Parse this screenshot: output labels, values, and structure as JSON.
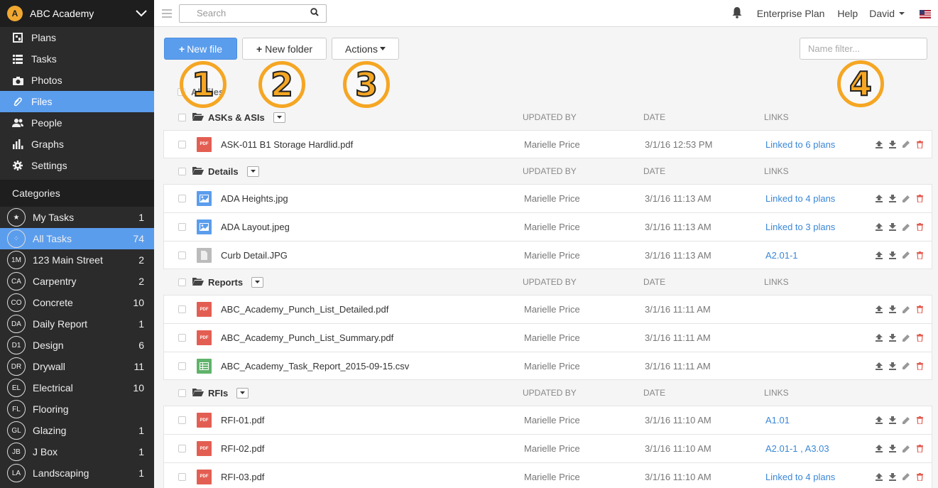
{
  "brand": {
    "logo_text": "A",
    "name": "ABC Academy"
  },
  "nav": [
    {
      "label": "Plans",
      "icon": "plans-icon"
    },
    {
      "label": "Tasks",
      "icon": "tasks-icon"
    },
    {
      "label": "Photos",
      "icon": "camera-icon"
    },
    {
      "label": "Files",
      "icon": "paperclip-icon",
      "active": true
    },
    {
      "label": "People",
      "icon": "people-icon"
    },
    {
      "label": "Graphs",
      "icon": "graph-icon"
    },
    {
      "label": "Settings",
      "icon": "gear-icon"
    }
  ],
  "categories_title": "Categories",
  "categories": [
    {
      "badge": "★",
      "label": "My Tasks",
      "count": "1"
    },
    {
      "badge": "⁘",
      "label": "All Tasks",
      "count": "74",
      "active": true
    },
    {
      "badge": "1M",
      "label": "123 Main Street",
      "count": "2"
    },
    {
      "badge": "CA",
      "label": "Carpentry",
      "count": "2"
    },
    {
      "badge": "CO",
      "label": "Concrete",
      "count": "10"
    },
    {
      "badge": "DA",
      "label": "Daily Report",
      "count": "1"
    },
    {
      "badge": "D1",
      "label": "Design",
      "count": "6"
    },
    {
      "badge": "DR",
      "label": "Drywall",
      "count": "11"
    },
    {
      "badge": "EL",
      "label": "Electrical",
      "count": "10"
    },
    {
      "badge": "FL",
      "label": "Flooring",
      "count": ""
    },
    {
      "badge": "GL",
      "label": "Glazing",
      "count": "1"
    },
    {
      "badge": "JB",
      "label": "J Box",
      "count": "1"
    },
    {
      "badge": "LA",
      "label": "Landscaping",
      "count": "1"
    }
  ],
  "topbar": {
    "search_placeholder": "Search",
    "plan": "Enterprise Plan",
    "help": "Help",
    "user": "David"
  },
  "toolbar": {
    "new_file": "New file",
    "new_folder": "New folder",
    "actions": "Actions",
    "filter_placeholder": "Name filter..."
  },
  "markers": [
    "1",
    "2",
    "3",
    "4"
  ],
  "all_label": "All files",
  "headers": {
    "updated_by": "UPDATED BY",
    "date": "DATE",
    "links": "LINKS"
  },
  "groups": [
    {
      "name": "ASKs & ASIs",
      "files": [
        {
          "type": "pdf",
          "name": "ASK-011 B1 Storage Hardlid.pdf",
          "by": "Marielle Price",
          "date": "3/1/16 12:53 PM",
          "links": "Linked to 6 plans"
        }
      ]
    },
    {
      "name": "Details",
      "files": [
        {
          "type": "img",
          "name": "ADA Heights.jpg",
          "by": "Marielle Price",
          "date": "3/1/16 11:13 AM",
          "links": "Linked to 4 plans"
        },
        {
          "type": "img",
          "name": "ADA Layout.jpeg",
          "by": "Marielle Price",
          "date": "3/1/16 11:13 AM",
          "links": "Linked to 3 plans"
        },
        {
          "type": "doc",
          "name": "Curb Detail.JPG",
          "by": "Marielle Price",
          "date": "3/1/16 11:13 AM",
          "links": "A2.01-1"
        }
      ]
    },
    {
      "name": "Reports",
      "files": [
        {
          "type": "pdf",
          "name": "ABC_Academy_Punch_List_Detailed.pdf",
          "by": "Marielle Price",
          "date": "3/1/16 11:11 AM",
          "links": ""
        },
        {
          "type": "pdf",
          "name": "ABC_Academy_Punch_List_Summary.pdf",
          "by": "Marielle Price",
          "date": "3/1/16 11:11 AM",
          "links": ""
        },
        {
          "type": "csv",
          "name": "ABC_Academy_Task_Report_2015-09-15.csv",
          "by": "Marielle Price",
          "date": "3/1/16 11:11 AM",
          "links": ""
        }
      ]
    },
    {
      "name": "RFIs",
      "files": [
        {
          "type": "pdf",
          "name": "RFI-01.pdf",
          "by": "Marielle Price",
          "date": "3/1/16 11:10 AM",
          "links": "A1.01"
        },
        {
          "type": "pdf",
          "name": "RFI-02.pdf",
          "by": "Marielle Price",
          "date": "3/1/16 11:10 AM",
          "links": "A2.01-1 , A3.03"
        },
        {
          "type": "pdf",
          "name": "RFI-03.pdf",
          "by": "Marielle Price",
          "date": "3/1/16 11:10 AM",
          "links": "Linked to 4 plans"
        }
      ]
    }
  ],
  "colors": {
    "accent": "#5b9ded",
    "sidebar": "#2b2b2b",
    "marker": "#f5a623",
    "link": "#3a87d6",
    "pdf": "#e35e52",
    "csv": "#5fb36a"
  }
}
